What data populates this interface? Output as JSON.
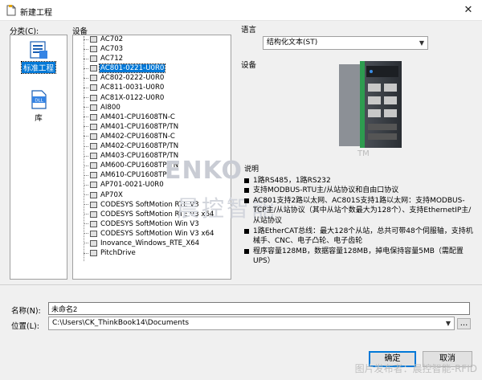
{
  "window": {
    "title": "新建工程",
    "close_glyph": "✕"
  },
  "category": {
    "label": "分类(C):",
    "items": [
      {
        "label": "标准工程",
        "icon": "standard-project-icon",
        "selected": true
      },
      {
        "label": "库",
        "icon": "library-icon",
        "selected": false
      }
    ]
  },
  "devices": {
    "label": "设备",
    "items": [
      "AC702",
      "AC703",
      "AC712",
      "AC801-0221-U0R0",
      "AC802-0222-U0R0",
      "AC811-0031-U0R0",
      "AC81X-0122-U0R0",
      "AI800",
      "AM401-CPU1608TN-C",
      "AM401-CPU1608TP/TN",
      "AM402-CPU1608TN-C",
      "AM402-CPU1608TP/TN",
      "AM403-CPU1608TP/TN",
      "AM600-CPU1608TP/TN",
      "AM610-CPU1608TP",
      "AP701-0021-U0R0",
      "AP70X",
      "CODESYS SoftMotion RTE V3",
      "CODESYS SoftMotion RTE V3 x64",
      "CODESYS SoftMotion Win V3",
      "CODESYS SoftMotion Win V3 x64",
      "Inovance_Windows_RTE_X64",
      "PitchDrive"
    ],
    "selected_index": 3
  },
  "language": {
    "label": "语言",
    "value": "结构化文本(ST)"
  },
  "device_preview": {
    "label": "设备",
    "tm": "TM"
  },
  "description": {
    "label": "说明",
    "items": [
      "1路RS485，1路RS232",
      "支持MODBUS-RTU主/从站协议和自由口协议",
      "AC801支持2路以太网、AC801S支持1路以太网：支持MODBUS-TCP主/从站协议（其中从站个数最大为128个）、支持EthernetIP主/从站协议",
      "1路EtherCAT总线：最大128个从站，总共可带48个伺服轴，支持机械手、CNC、电子凸轮、电子齿轮",
      "程序容量128MB，数据容量128MB，掉电保持容量5MB（需配置UPS）"
    ]
  },
  "name_field": {
    "label": "名称(N):",
    "value": "未命名2"
  },
  "location_field": {
    "label": "位置(L):",
    "value": "C:\\Users\\CK_ThinkBook14\\Documents",
    "browse_label": "..."
  },
  "buttons": {
    "ok": "确定",
    "cancel": "取消"
  },
  "watermark": {
    "brand": "ENKO",
    "brand_cn": "晨控智能",
    "footer": "图片发布者：晨控智能-RFID"
  },
  "colors": {
    "selection": "#0078d7",
    "primary_border": "#0078d7"
  }
}
